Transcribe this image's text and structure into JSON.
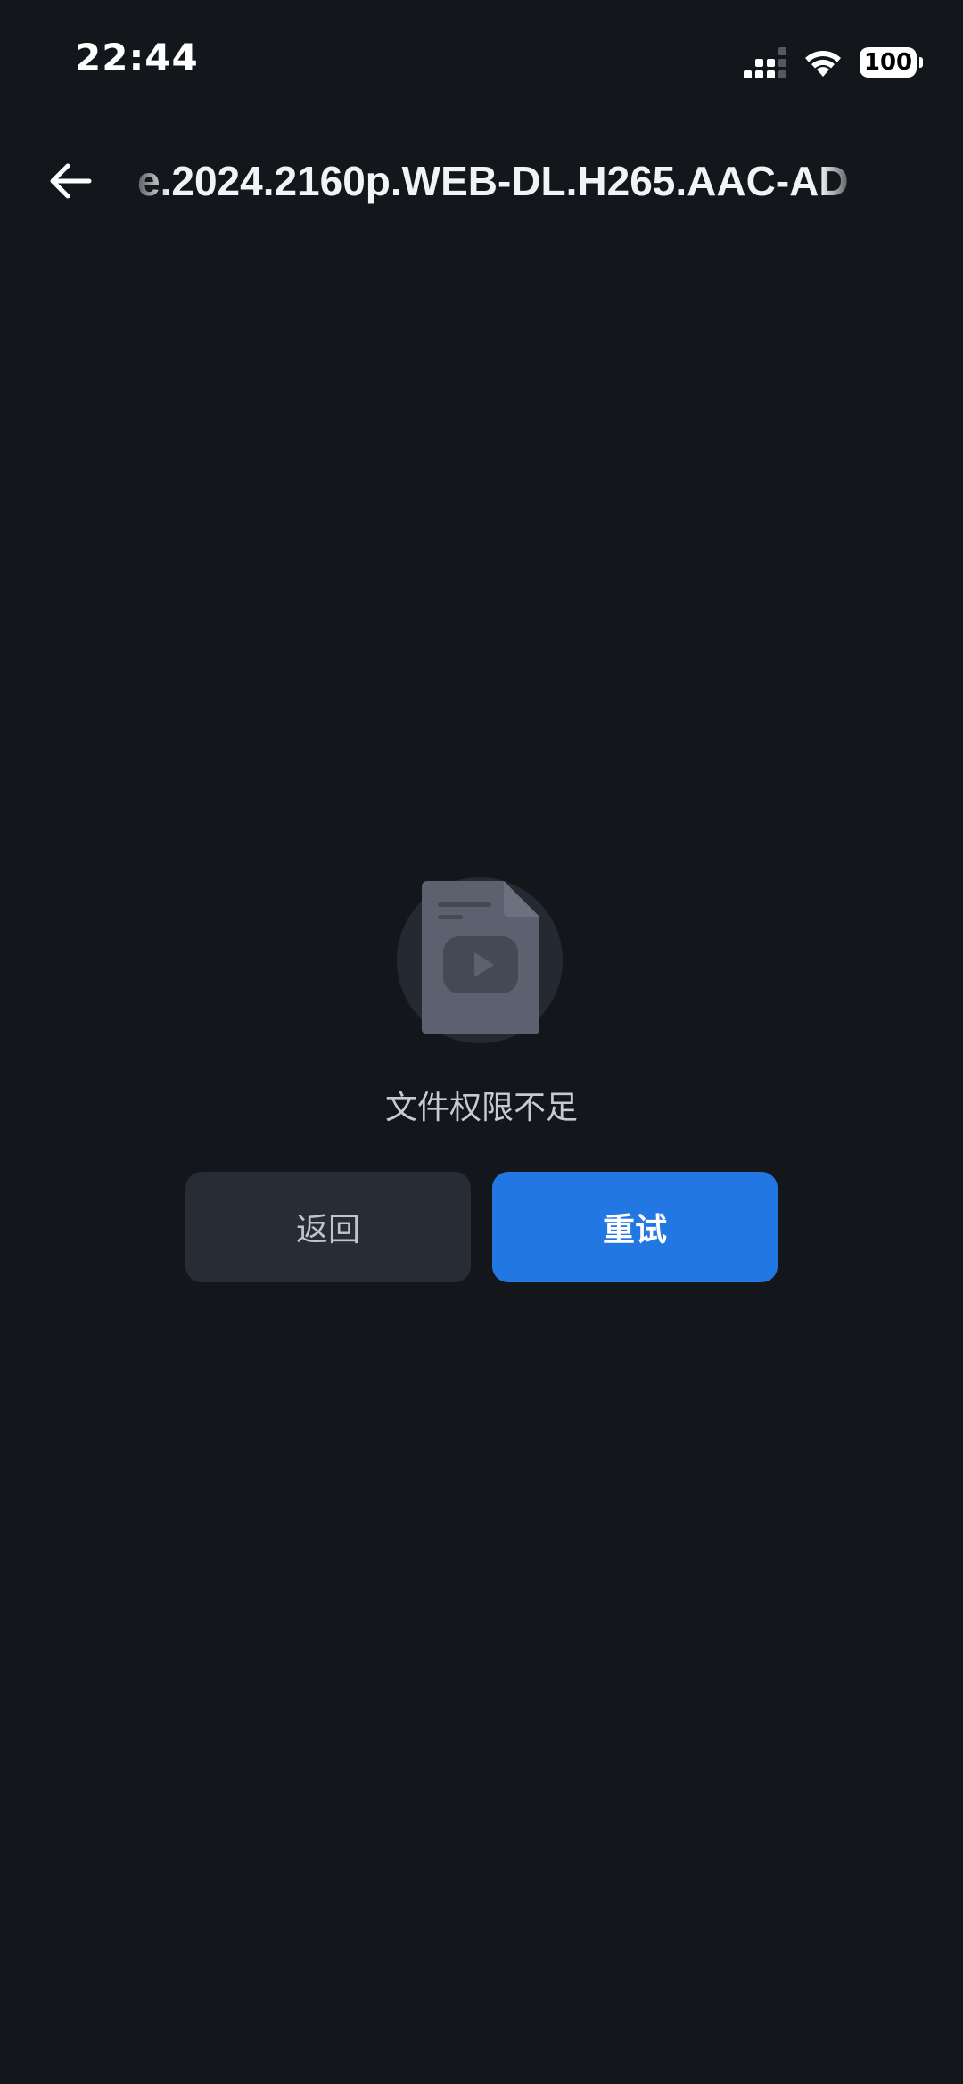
{
  "status_bar": {
    "time": "22:44",
    "battery": "100",
    "icons": [
      "signal-icon",
      "wifi-icon",
      "battery-icon"
    ]
  },
  "header": {
    "back_icon": "arrow-left-icon",
    "title": "e.2024.2160p.WEB-DL.H265.AAC-AD"
  },
  "error": {
    "icon": "video-file-icon",
    "message": "文件权限不足"
  },
  "actions": {
    "back_label": "返回",
    "retry_label": "重试"
  },
  "colors": {
    "background": "#13171c",
    "secondary_button": "#272c35",
    "primary_button": "#2277e3",
    "icon_circle": "#252a32",
    "icon_fill": "#5c6170"
  }
}
